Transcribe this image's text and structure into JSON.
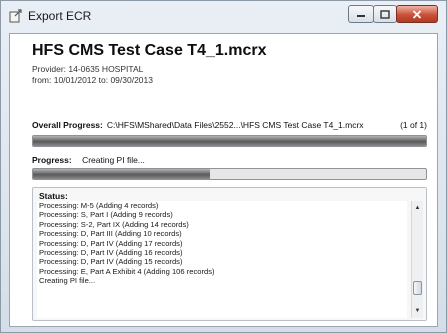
{
  "window": {
    "title": "Export ECR"
  },
  "header": {
    "case_title": "HFS CMS Test Case T4_1.mcrx",
    "provider": "Provider: 14-0635  HOSPITAL",
    "dates": "from: 10/01/2012  to: 09/30/2013"
  },
  "overall": {
    "label": "Overall Progress:",
    "path": "C:\\HFS\\MShared\\Data Files\\2552...\\HFS CMS Test Case T4_1.mcrx",
    "count": "(1 of 1)",
    "fraction": 1.0
  },
  "progress": {
    "label": "Progress:",
    "text": "Creating PI file...",
    "fraction": 0.45
  },
  "status": {
    "label": "Status:",
    "lines": [
      "Processing: M-5 (Adding 4 records)",
      "Processing: S, Part I (Adding 9 records)",
      "Processing: S-2, Part IX (Adding 14 records)",
      "Processing: D, Part III (Adding 10 records)",
      "Processing: D, Part IV (Adding 17 records)",
      "Processing: D, Part IV (Adding 16 records)",
      "Processing: D, Part IV (Adding 15 records)",
      "Processing: E, Part A Exhibit 4 (Adding 106 records)",
      "Creating PI file..."
    ]
  },
  "icons": {
    "app": "export-icon",
    "minimize": "minimize-icon",
    "maximize": "maximize-icon",
    "close": "close-icon"
  }
}
